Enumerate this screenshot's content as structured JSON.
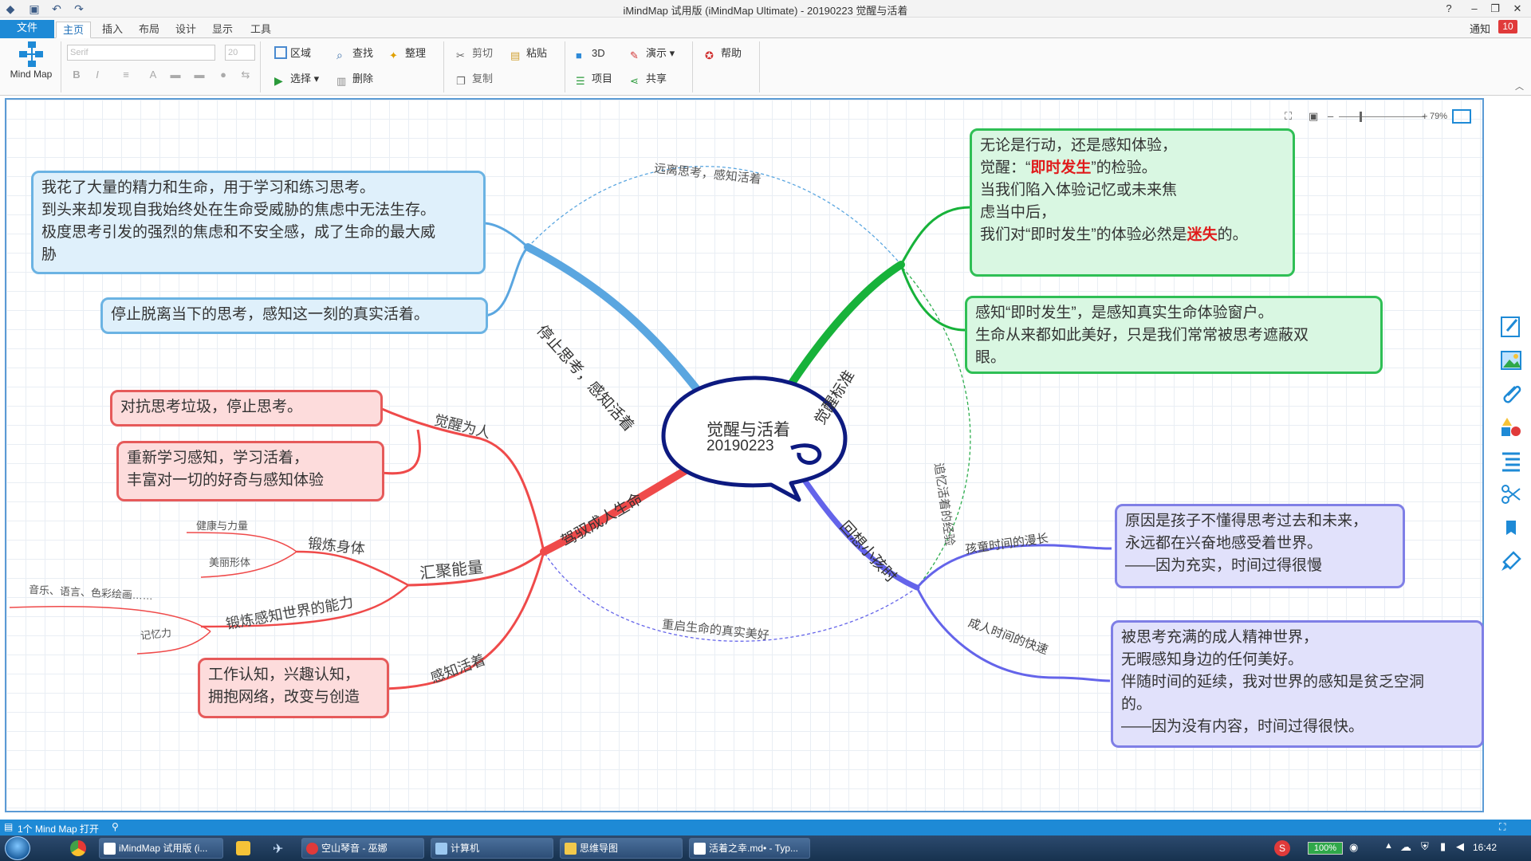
{
  "app": {
    "window_title": "iMindMap 试用版 (iMindMap Ultimate) - 20190223 觉醒与活着",
    "help_glyph": "?"
  },
  "tabs": {
    "file": "文件",
    "items": [
      "主页",
      "插入",
      "布局",
      "设计",
      "显示",
      "工具"
    ],
    "notify_label": "通知",
    "notify_count": "10"
  },
  "ribbon": {
    "mindmap_label": "Mind Map",
    "font_name": "Serif",
    "font_size": "20",
    "area": "区域",
    "select": "选择",
    "find": "查找",
    "delete": "删除",
    "arrange": "整理",
    "cut": "剪切",
    "copy": "复制",
    "paste": "粘贴",
    "threed": "3D",
    "present": "演示",
    "project": "项目",
    "share": "共享",
    "help": "帮助"
  },
  "canvas": {
    "zoom": "79%"
  },
  "map": {
    "central": {
      "title": "觉醒与活着",
      "date": "20190223"
    },
    "branches": {
      "stop_thinking": "停止思考，感知活着",
      "awake_standard": "觉醒标准",
      "recall_child": "回想小孩时",
      "drive_life": "驾驭成人生命"
    },
    "sub": {
      "awake_person": "觉醒为人",
      "gather_energy": "汇聚能量",
      "sense_alive": "感知活着",
      "exercise_body": "锻炼身体",
      "exercise_perception": "锻炼感知世界的能力",
      "health": "健康与力量",
      "beauty": "美丽形体",
      "arts": "音乐、语言、色彩绘画……",
      "memory": "记忆力",
      "child_time": "孩童时间的漫长",
      "adult_time": "成人时间的快速"
    },
    "relations": {
      "top": "远离思考，感知活着",
      "right": "追忆活着的经验",
      "bottom": "重启生命的真实美好"
    },
    "boxes": {
      "blue1": "我花了大量的精力和生命，用于学习和练习思考。\n到头来却发现自我始终处在生命受威胁的焦虑中无法生存。\n极度思考引发的强烈的焦虑和不安全感，成了生命的最大威\n胁",
      "blue2": "停止脱离当下的思考，感知这一刻的真实活着。",
      "green1_a": "无论是行动，还是感知体验，\n觉醒：“",
      "green1_hl1": "即时发生",
      "green1_b": "”的检验。\n当我们陷入体验记忆或未来焦\n虑当中后，\n我们对“即时发生”的体验必然是",
      "green1_hl2": "迷失",
      "green1_c": "的。",
      "green2": "感知“即时发生”，是感知真实生命体验窗户。\n生命从来都如此美好，只是我们常常被思考遮蔽双\n眼。",
      "red1": "对抗思考垃圾，停止思考。",
      "red2": "重新学习感知，学习活着，\n丰富对一切的好奇与感知体验",
      "red3": "工作认知，兴趣认知，\n拥抱网络，改变与创造",
      "purple1": "原因是孩子不懂得思考过去和未来，\n永远都在兴奋地感受着世界。\n——因为充实，时间过得很慢",
      "purple2": "被思考充满的成人精神世界，\n无暇感知身边的任何美好。\n伴随时间的延续，我对世界的感知是贫乏空洞\n的。\n——因为没有内容，时间过得很快。"
    }
  },
  "statusbar": {
    "text": "1个 Mind Map 打开"
  },
  "taskbar": {
    "items": [
      "iMindMap 试用版 (i...",
      "空山琴音 - 巫娜",
      "计算机",
      "思维导图",
      "活着之幸.md• - Typ..."
    ],
    "battery": "100%",
    "time": "16:42"
  },
  "colors": {
    "accent": "#1e8ad6",
    "blue_branch": "#5aa6e0",
    "green_branch": "#17b23a",
    "purple_branch": "#6464ea",
    "red_branch": "#ef4a4a",
    "central_stroke": "#0d1a80"
  }
}
